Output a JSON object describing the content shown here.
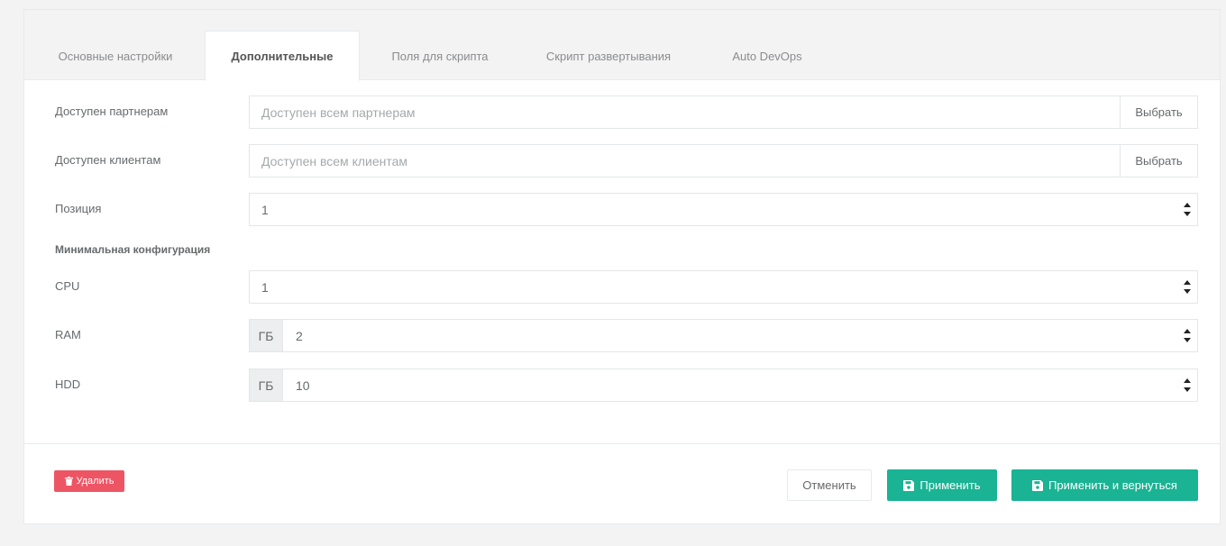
{
  "tabs": [
    {
      "label": "Основные настройки",
      "active": false
    },
    {
      "label": "Дополнительные",
      "active": true
    },
    {
      "label": "Поля для скрипта",
      "active": false
    },
    {
      "label": "Скрипт развертывания",
      "active": false
    },
    {
      "label": "Auto DevOps",
      "active": false
    }
  ],
  "form": {
    "partners": {
      "label": "Доступен партнерам",
      "placeholder": "Доступен всем партнерам",
      "button": "Выбрать"
    },
    "clients": {
      "label": "Доступен клиентам",
      "placeholder": "Доступен всем клиентам",
      "button": "Выбрать"
    },
    "position": {
      "label": "Позиция",
      "value": "1"
    },
    "min_config_title": "Минимальная конфигурация",
    "cpu": {
      "label": "CPU",
      "value": "1"
    },
    "ram": {
      "label": "RAM",
      "unit": "ГБ",
      "value": "2"
    },
    "hdd": {
      "label": "HDD",
      "unit": "ГБ",
      "value": "10"
    }
  },
  "footer": {
    "delete_label": "Удалить",
    "cancel_label": "Отменить",
    "apply_label": "Применить",
    "apply_back_label": "Применить и вернуться"
  },
  "colors": {
    "primary": "#1ab394",
    "danger": "#ed5565",
    "background": "#f3f3f4"
  },
  "icons": {
    "delete": "trash-icon",
    "save": "floppy-disk-icon",
    "spinner_up": "caret-up-icon",
    "spinner_down": "caret-down-icon"
  }
}
